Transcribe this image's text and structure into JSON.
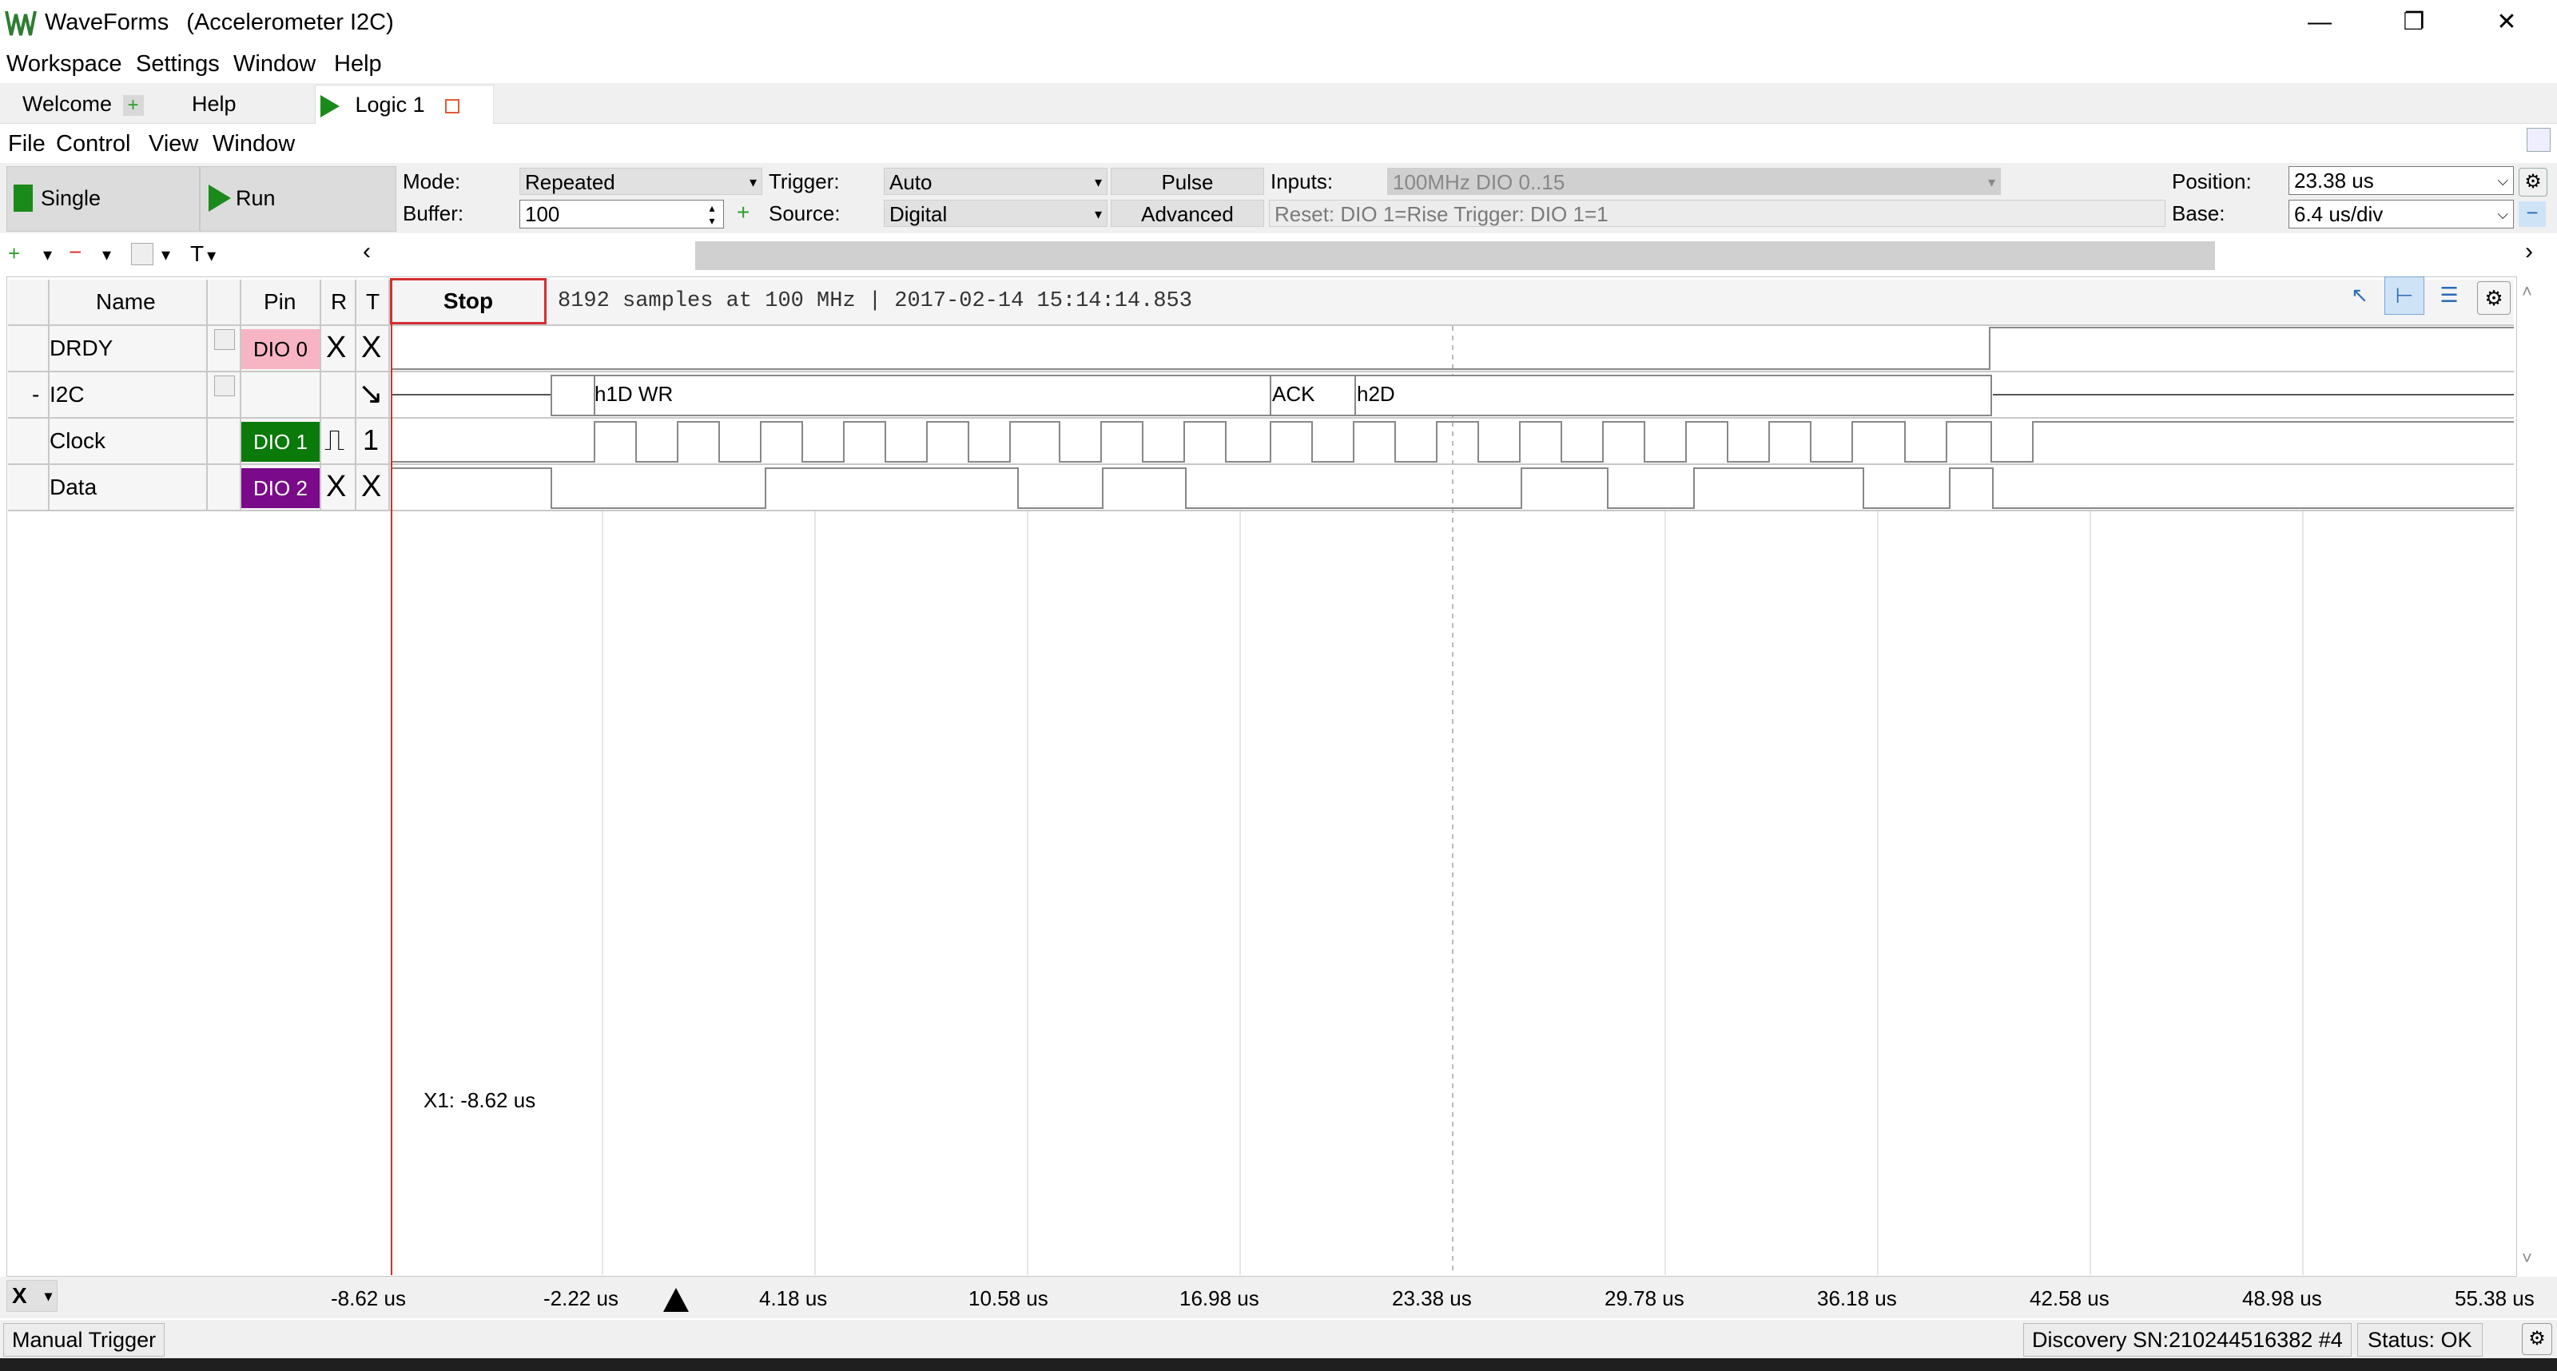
{
  "window": {
    "app_name": "WaveForms",
    "doc_name": "(Accelerometer I2C)",
    "minimize_glyph": "—",
    "restore_glyph": "❐",
    "close_glyph": "✕"
  },
  "menubar": [
    "Workspace",
    "Settings",
    "Window",
    "Help"
  ],
  "tabs": [
    {
      "label": "Welcome"
    },
    {
      "label": "Help"
    },
    {
      "label": "Logic 1"
    }
  ],
  "submenu": [
    "File",
    "Control",
    "View",
    "Window"
  ],
  "toolbar": {
    "single_label": "Single",
    "run_label": "Run",
    "mode_label": "Mode:",
    "mode_value": "Repeated",
    "buffer_label": "Buffer:",
    "buffer_value": "100",
    "trigger_label": "Trigger:",
    "trigger_value": "Auto",
    "source_label": "Source:",
    "source_value": "Digital",
    "pulse_label": "Pulse",
    "advanced_label": "Advanced",
    "inputs_label": "Inputs:",
    "inputs_value": "100MHz DIO 0..15",
    "reset_text": "Reset: DIO 1=Rise Trigger: DIO 1=1",
    "position_label": "Position:",
    "position_value": "23.38 us",
    "base_label": "Base:",
    "base_value": "6.4 us/div"
  },
  "iconbar": {
    "t_label": "T"
  },
  "grid": {
    "headers": {
      "name": "Name",
      "pin": "Pin",
      "r": "R",
      "t": "T"
    },
    "stop_label": "Stop",
    "info": "8192 samples at 100 MHz | 2017-02-14 15:14:14.853",
    "rows": [
      {
        "name": "DRDY",
        "pin": "DIO  0",
        "pin_color": "#f7b5c4",
        "r": "X",
        "t": "X"
      },
      {
        "name": "I2C",
        "prefix": "-",
        "pin": "",
        "pin_color": "",
        "r": "",
        "t": "↘"
      },
      {
        "name": "Clock",
        "pin": "DIO  1",
        "pin_color": "#0a7a0a",
        "r": "⎍",
        "t": "1"
      },
      {
        "name": "Data",
        "pin": "DIO  2",
        "pin_color": "#7a0a8a",
        "r": "X",
        "t": "X"
      }
    ],
    "i2c_labels": [
      "h1D WR",
      "ACK",
      "h2D"
    ],
    "cursor_label": "X1: -8.62 us"
  },
  "axis": {
    "x_label": "X",
    "ticks": [
      "-8.62 us",
      "-2.22 us",
      "4.18 us",
      "10.58 us",
      "16.98 us",
      "23.38 us",
      "29.78 us",
      "36.18 us",
      "42.58 us",
      "48.98 us",
      "55.38 us"
    ]
  },
  "status": {
    "left": "Manual Trigger",
    "device": "Discovery SN:210244516382 #4",
    "state": "Status: OK"
  }
}
